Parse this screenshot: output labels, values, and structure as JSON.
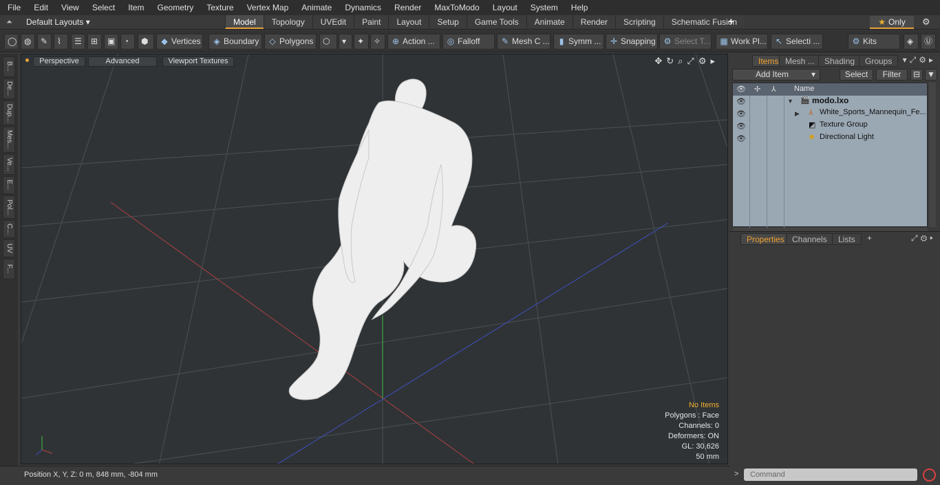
{
  "menu": [
    "File",
    "Edit",
    "View",
    "Select",
    "Item",
    "Geometry",
    "Texture",
    "Vertex Map",
    "Animate",
    "Dynamics",
    "Render",
    "MaxToModo",
    "Layout",
    "System",
    "Help"
  ],
  "layout": {
    "default_label": "Default Layouts ▾",
    "tabs": [
      "Model",
      "Topology",
      "UVEdit",
      "Paint",
      "Layout",
      "Setup",
      "Game Tools",
      "Animate",
      "Render",
      "Scripting",
      "Schematic Fusion"
    ],
    "active_tab": "Model",
    "only_label": "Only"
  },
  "toolbar": {
    "vertices": "Vertices",
    "boundary": "Boundary",
    "polygons": "Polygons",
    "action": "Action",
    "falloff": "Falloff",
    "mesh_c": "Mesh C ...",
    "symm": "Symm ...",
    "snapping": "Snapping",
    "select_t": "Select T...",
    "work_pl": "Work Pl...",
    "selecti": "Selecti ...",
    "kits": "Kits"
  },
  "left_tabs": [
    "B...",
    "De...",
    "Dup...",
    "Mes...",
    "Ve...",
    "E...",
    "Pol...",
    "C...",
    "UV",
    "F..."
  ],
  "viewport": {
    "view_mode": "Perspective",
    "shading": "Advanced",
    "textures": "Viewport Textures",
    "stats": {
      "selection": "No Items",
      "polygons": "Polygons : Face",
      "channels": "Channels: 0",
      "deformers": "Deformers: ON",
      "gl": "GL: 30,626",
      "unit": "50 mm"
    }
  },
  "status": {
    "position": "Position X, Y, Z:   0 m, 848 mm, -804 mm"
  },
  "items_panel": {
    "tabs": [
      "Items",
      "Mesh ...",
      "Shading",
      "Groups"
    ],
    "active_tab": "Items",
    "add_item": "Add Item",
    "select": "Select",
    "filter": "Filter",
    "column_name": "Name",
    "rows": [
      {
        "label": "modo.lxo",
        "icon": "scene-icon"
      },
      {
        "label": "White_Sports_Mannequin_Fe...",
        "icon": "mesh-icon"
      },
      {
        "label": "Texture Group",
        "icon": "texture-group-icon"
      },
      {
        "label": "Directional Light",
        "icon": "light-icon"
      }
    ]
  },
  "props_panel": {
    "tabs": [
      "Properties",
      "Channels",
      "Lists"
    ],
    "active_tab": "Properties"
  },
  "command": {
    "placeholder": "Command"
  },
  "colors": {
    "accent": "#e8a33a",
    "viewport_bg": "#2f3336",
    "items_bg": "#9aa8b4"
  }
}
